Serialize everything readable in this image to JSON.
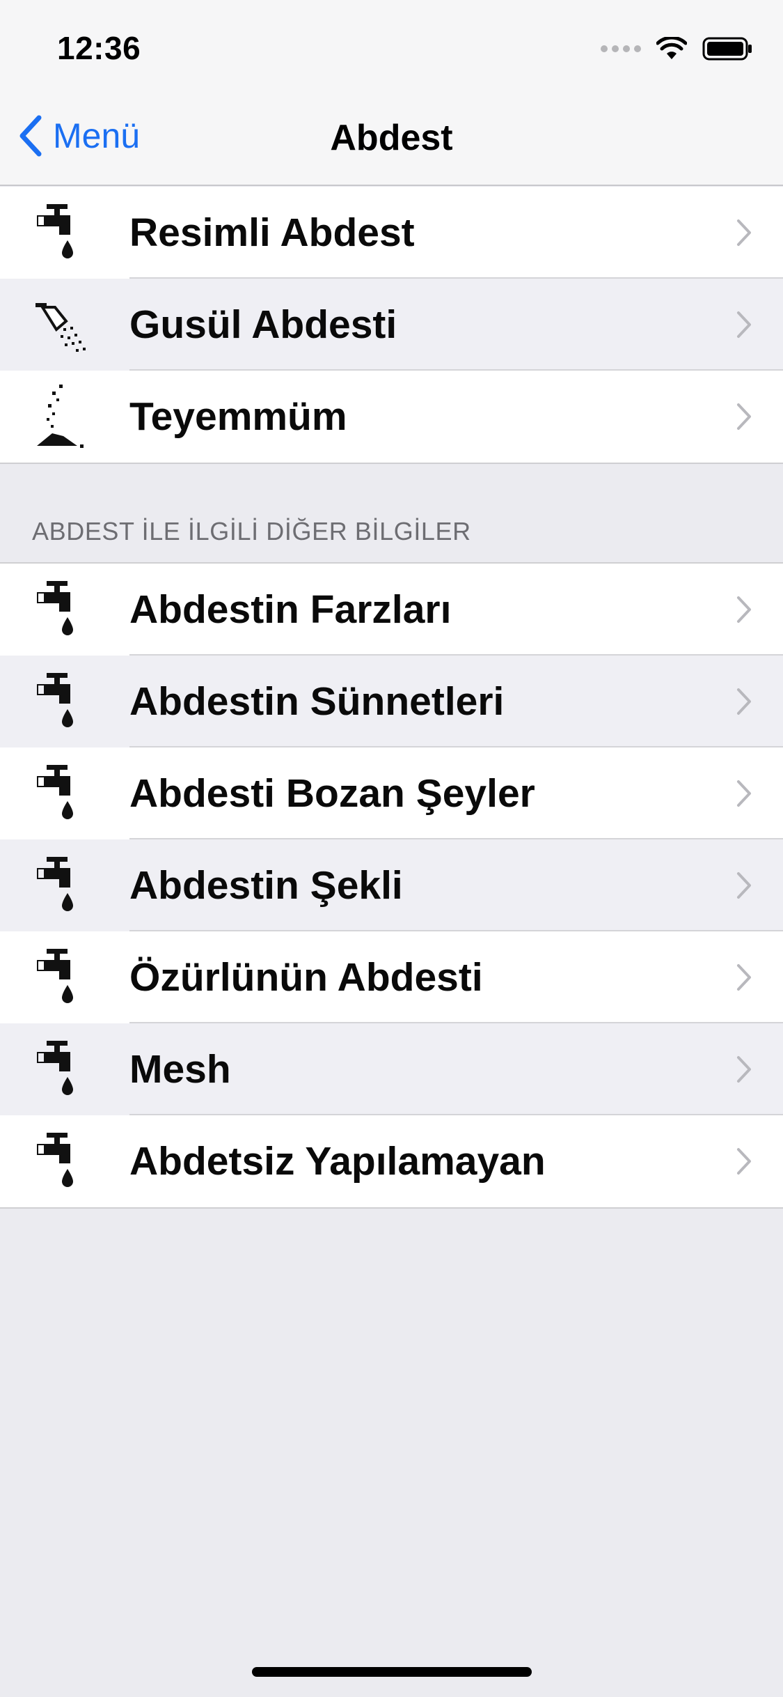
{
  "status_bar": {
    "time": "12:36"
  },
  "nav": {
    "back_label": "Menü",
    "title": "Abdest"
  },
  "group1": [
    {
      "label": "Resimli Abdest",
      "icon": "faucet-icon"
    },
    {
      "label": "Gusül Abdesti",
      "icon": "shower-icon"
    },
    {
      "label": "Teyemmüm",
      "icon": "soil-icon"
    }
  ],
  "section_header": "ABDEST İLE İLGİLİ DİĞER BİLGİLER",
  "group2": [
    {
      "label": "Abdestin Farzları",
      "icon": "faucet-icon"
    },
    {
      "label": "Abdestin Sünnetleri",
      "icon": "faucet-icon"
    },
    {
      "label": "Abdesti Bozan Şeyler",
      "icon": "faucet-icon"
    },
    {
      "label": "Abdestin Şekli",
      "icon": "faucet-icon"
    },
    {
      "label": "Özürlünün Abdesti",
      "icon": "faucet-icon"
    },
    {
      "label": "Mesh",
      "icon": "faucet-icon"
    },
    {
      "label": "Abdetsiz Yapılamayan",
      "icon": "faucet-icon"
    }
  ],
  "colors": {
    "accent": "#1B6FF2",
    "background": "#EBEBF0",
    "row_alt": "#EFEFF4"
  }
}
